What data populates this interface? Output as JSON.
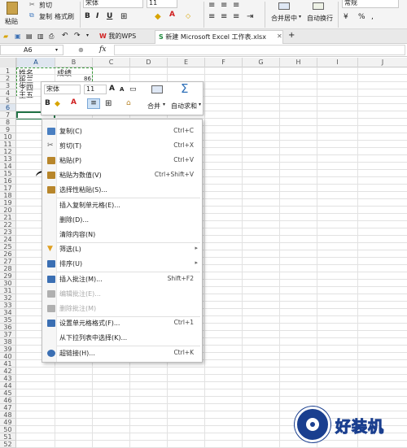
{
  "ribbon": {
    "paste_label": "粘贴",
    "cut_label": "剪切",
    "copy_label": "复制",
    "format_painter_label": "格式刷",
    "font_name": "宋体",
    "font_size": "11",
    "bold": "B",
    "italic": "I",
    "underline": "U",
    "merge_center_label": "合并居中",
    "wrap_text_label": "自动换行",
    "number_format": "常规",
    "number_format_pct": "%",
    "accent_color": "#2e75b6"
  },
  "tabs": {
    "my_wps": "我的WPS",
    "active_file": "新建 Microsoft Excel 工作表.xlsx",
    "add_tab": "+"
  },
  "formula": {
    "name_box": "A6",
    "fx": "fx"
  },
  "columns": [
    "A",
    "B",
    "C",
    "D",
    "E",
    "F",
    "G",
    "H",
    "I",
    "J"
  ],
  "rows": [
    "1",
    "2",
    "3",
    "4",
    "5",
    "6",
    "7",
    "8",
    "9",
    "10",
    "11",
    "12",
    "13",
    "14",
    "15",
    "16",
    "17",
    "18",
    "19",
    "20",
    "21",
    "22",
    "23",
    "24",
    "25",
    "26",
    "27",
    "28",
    "29",
    "30",
    "31",
    "32",
    "33",
    "34",
    "35",
    "36",
    "37",
    "38",
    "39",
    "40",
    "41",
    "42",
    "43",
    "44",
    "45",
    "46",
    "47",
    "48",
    "49",
    "50",
    "51",
    "52"
  ],
  "cells": {
    "a1": "姓名",
    "b1": "成绩",
    "a2": "张三",
    "b2_partial": "86",
    "a3": "李四",
    "a4": "王五"
  },
  "mini_toolbar": {
    "font_name": "宋体",
    "font_size": "11",
    "grow_font": "A",
    "shrink_font": "A",
    "bold": "B",
    "font_color": "A",
    "merge_label": "合并",
    "autosum_label": "自动求和",
    "merge_arrow": "▾",
    "autosum_arrow": "▾"
  },
  "context_menu": {
    "items": [
      {
        "label": "复制(C)",
        "shortcut": "Ctrl+C",
        "icon": "copy-icon",
        "color": "#4a7fc1"
      },
      {
        "label": "剪切(T)",
        "shortcut": "Ctrl+X",
        "icon": "scissors-icon",
        "color": "#5a5a5a"
      },
      {
        "label": "粘贴(P)",
        "shortcut": "Ctrl+V",
        "icon": "paste-icon",
        "color": "#b8862b"
      },
      {
        "label": "粘贴为数值(V)",
        "shortcut": "Ctrl+Shift+V",
        "icon": "paste-values-icon",
        "color": "#b8862b"
      },
      {
        "label": "选择性粘贴(S)...",
        "shortcut": "",
        "icon": "paste-special-icon",
        "color": "#b8862b"
      },
      {
        "label": "插入复制单元格(E)...",
        "shortcut": "",
        "icon": "",
        "color": ""
      },
      {
        "label": "删除(D)...",
        "shortcut": "",
        "icon": "",
        "color": ""
      },
      {
        "label": "清除内容(N)",
        "shortcut": "",
        "icon": "",
        "color": ""
      },
      {
        "label": "筛选(L)",
        "shortcut": "",
        "icon": "filter-icon",
        "color": "#e0a020",
        "submenu": "▸"
      },
      {
        "label": "排序(U)",
        "shortcut": "",
        "icon": "sort-icon",
        "color": "#3b6fb3",
        "submenu": "▸"
      },
      {
        "label": "插入批注(M)...",
        "shortcut": "Shift+F2",
        "icon": "insert-comment-icon",
        "color": "#3b6fb3"
      },
      {
        "label": "编辑批注(E)...",
        "shortcut": "",
        "icon": "edit-comment-icon",
        "color": "#b0b0b0"
      },
      {
        "label": "删除批注(M)",
        "shortcut": "",
        "icon": "delete-comment-icon",
        "color": "#b0b0b0"
      },
      {
        "label": "设置单元格格式(F)...",
        "shortcut": "Ctrl+1",
        "icon": "format-cells-icon",
        "color": "#3b6fb3"
      },
      {
        "label": "从下拉列表中选择(K)...",
        "shortcut": "",
        "icon": "",
        "color": ""
      },
      {
        "label": "超链接(H)...",
        "shortcut": "Ctrl+K",
        "icon": "hyperlink-icon",
        "color": "#3b6fb3"
      }
    ]
  },
  "watermark": {
    "text": "好装机"
  },
  "annotation_color": "#cc1111"
}
